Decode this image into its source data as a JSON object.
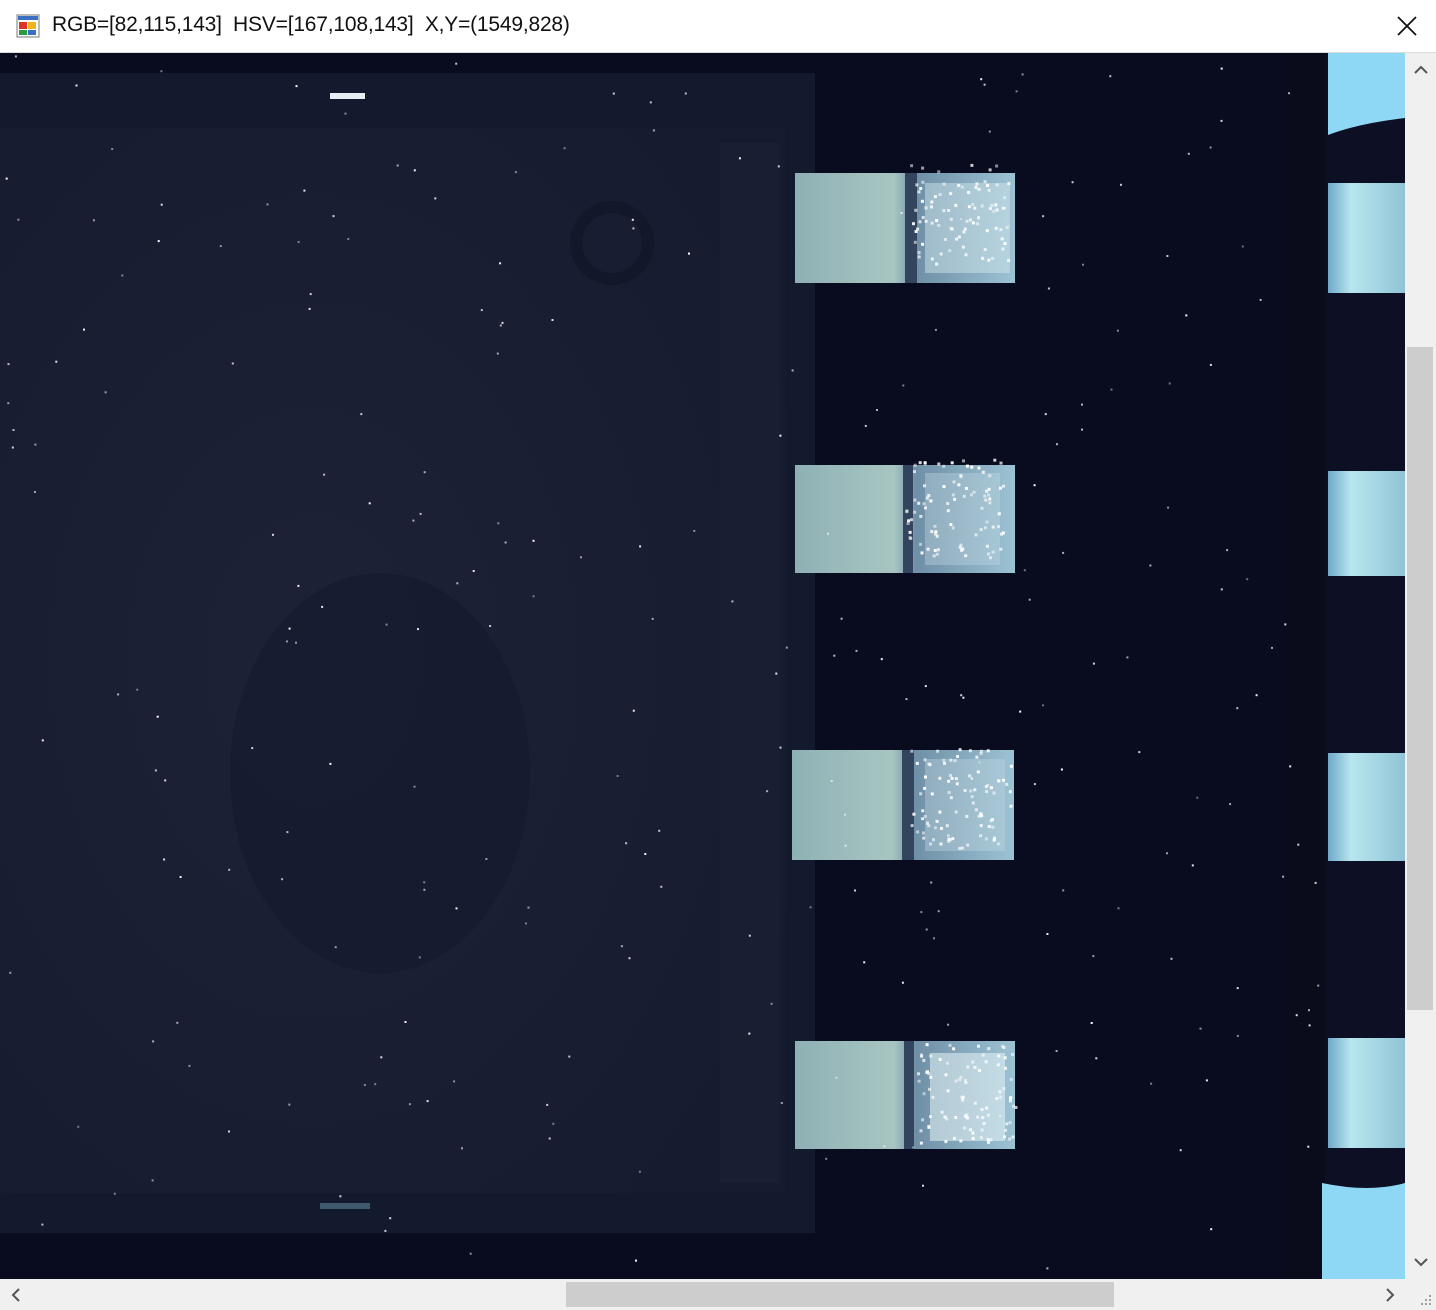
{
  "window": {
    "title": "RGB=[82,115,143]  HSV=[167,108,143]  X,Y=(1549,828)",
    "icons": {
      "app": "app-window-icon",
      "close": "close-icon"
    }
  },
  "image_view": {
    "subject": "microscope image of an IC package edge with four metal leads",
    "lead_count": 4,
    "colors": {
      "background": "#090b1e",
      "package_body": "#1c2238",
      "lead_metal": "#9cc0c4",
      "side_strip": "#8fd4f0"
    }
  },
  "scrollbars": {
    "vertical": {
      "up_icon": "chevron-up-icon",
      "down_icon": "chevron-down-icon",
      "position": 0.28
    },
    "horizontal": {
      "left_icon": "chevron-left-icon",
      "right_icon": "chevron-right-icon",
      "position": 0.67
    },
    "grip_icon": "resize-grip-icon"
  }
}
